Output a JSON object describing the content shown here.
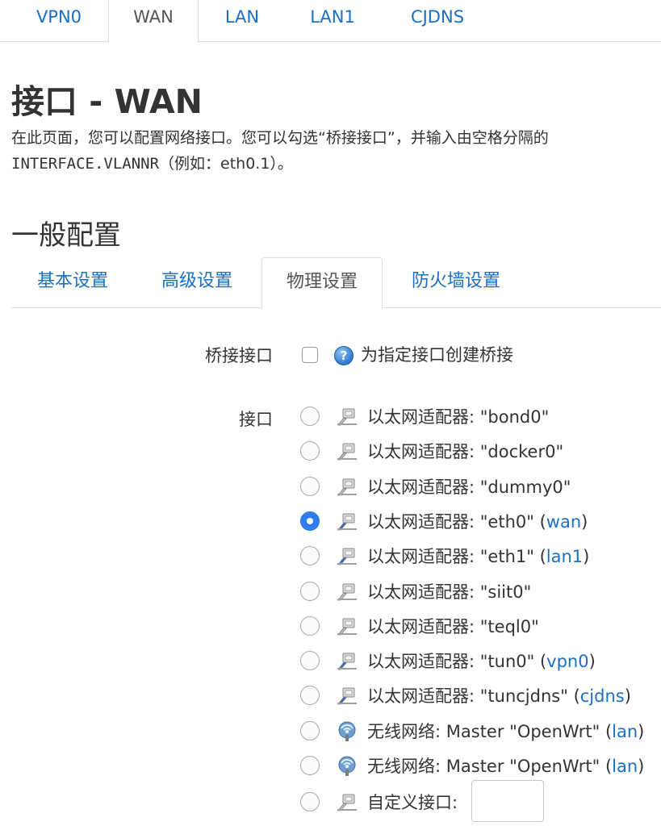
{
  "top_tabs": [
    {
      "label": "VPN0",
      "active": false
    },
    {
      "label": "WAN",
      "active": true
    },
    {
      "label": "LAN",
      "active": false
    },
    {
      "label": "LAN1",
      "active": false
    },
    {
      "label": "CJDNS",
      "active": false
    }
  ],
  "page_title": "接口 - WAN",
  "description": {
    "line1": "在此页面，您可以配置网络接口。您可以勾选“桥接接口”，并输入由空格分隔的",
    "line2_mono": "INTERFACE.VLANNR",
    "line2_rest": "（例如：eth0.1）。"
  },
  "section_title": "一般配置",
  "sub_tabs": [
    {
      "label": "基本设置",
      "active": false
    },
    {
      "label": "高级设置",
      "active": false
    },
    {
      "label": "物理设置",
      "active": true
    },
    {
      "label": "防火墙设置",
      "active": false
    }
  ],
  "bridge": {
    "label": "桥接接口",
    "checked": false,
    "help_icon": "help-icon",
    "help_text": "为指定接口创建桥接"
  },
  "interface": {
    "label": "接口",
    "options": [
      {
        "type": "ethernet",
        "prefix": "以太网适配器: ",
        "name": "\"bond0\"",
        "network": "",
        "checked": false
      },
      {
        "type": "ethernet",
        "prefix": "以太网适配器: ",
        "name": "\"docker0\"",
        "network": "",
        "checked": false
      },
      {
        "type": "ethernet",
        "prefix": "以太网适配器: ",
        "name": "\"dummy0\"",
        "network": "",
        "checked": false
      },
      {
        "type": "ethernet",
        "prefix": "以太网适配器: ",
        "name": "\"eth0\"",
        "network": "wan",
        "checked": true
      },
      {
        "type": "ethernet",
        "prefix": "以太网适配器: ",
        "name": "\"eth1\"",
        "network": "lan1",
        "checked": false
      },
      {
        "type": "ethernet",
        "prefix": "以太网适配器: ",
        "name": "\"siit0\"",
        "network": "",
        "checked": false
      },
      {
        "type": "ethernet",
        "prefix": "以太网适配器: ",
        "name": "\"teql0\"",
        "network": "",
        "checked": false
      },
      {
        "type": "ethernet",
        "prefix": "以太网适配器: ",
        "name": "\"tun0\"",
        "network": "vpn0",
        "checked": false
      },
      {
        "type": "ethernet",
        "prefix": "以太网适配器: ",
        "name": "\"tuncjdns\"",
        "network": "cjdns",
        "checked": false
      },
      {
        "type": "wireless",
        "prefix": "无线网络: ",
        "name": "Master \"OpenWrt\"",
        "network": "lan",
        "checked": false
      },
      {
        "type": "wireless",
        "prefix": "无线网络: ",
        "name": "Master \"OpenWrt\"",
        "network": "lan",
        "checked": false
      }
    ],
    "custom_label": "自定义接口:",
    "custom_value": ""
  },
  "colors": {
    "link": "#1a6fc6",
    "radio_checked": "#2f7ef0",
    "text": "#333333",
    "border": "#dddddd"
  }
}
